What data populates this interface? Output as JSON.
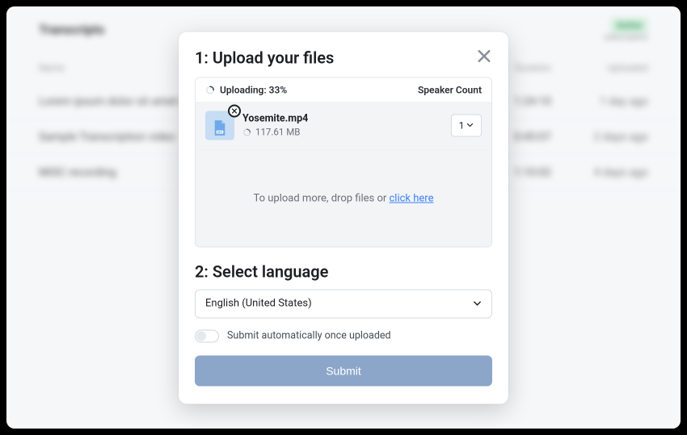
{
  "background": {
    "page_title": "Transcripts",
    "badge": "Active",
    "badge_sub": "subscription",
    "columns": {
      "c1": "Name",
      "c2": "Duration",
      "c3": "Uploaded"
    },
    "rows": [
      {
        "c1": "Lorem ipsum dolor sit amet consec",
        "c2": "1:24:10",
        "c3": "1 day ago"
      },
      {
        "c1": "Sample Transcription video",
        "c2": "0:45:07",
        "c3": "2 days ago"
      },
      {
        "c1": "MISC recording",
        "c2": "1:10:02",
        "c3": "4 days ago"
      }
    ]
  },
  "modal": {
    "step1_title": "1: Upload your files",
    "upload_status_prefix": "Uploading:",
    "upload_percent": "33%",
    "speaker_count_label": "Speaker Count",
    "file": {
      "name": "Yosemite.mp4",
      "size": "117.61 MB",
      "speakers": "1"
    },
    "drop_text_prefix": "To upload more, drop files or ",
    "drop_link": "click here",
    "step2_title": "2: Select language",
    "language": "English (United States)",
    "auto_submit_label": "Submit automatically once uploaded",
    "submit_label": "Submit"
  }
}
